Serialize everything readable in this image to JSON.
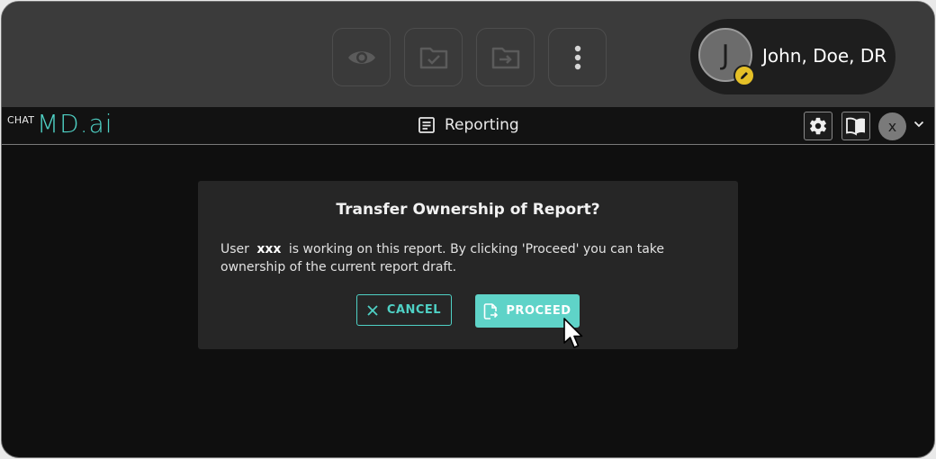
{
  "toolbar": {
    "buttons": [
      {
        "icon": "eye-icon"
      },
      {
        "icon": "folder-check-icon"
      },
      {
        "icon": "folder-arrow-icon"
      },
      {
        "icon": "more-vertical-icon"
      }
    ]
  },
  "user": {
    "initial": "J",
    "name": "John, Doe, DR",
    "badge_color": "#e5c027"
  },
  "app": {
    "logo_prefix": "CHAT",
    "logo_main": "MD.ai",
    "logo_color": "#4fd1c5",
    "title": "Reporting",
    "avatar_initial": "x"
  },
  "dialog": {
    "title": "Transfer Ownership of Report?",
    "message_prefix": "User",
    "message_user": "xxx",
    "message_suffix": "is working on this report. By clicking 'Proceed' you can take ownership of the current report draft.",
    "cancel_label": "CANCEL",
    "proceed_label": "PROCEED"
  },
  "colors": {
    "accent": "#4fd1c5",
    "proceed_bg": "#5fd3c8"
  }
}
